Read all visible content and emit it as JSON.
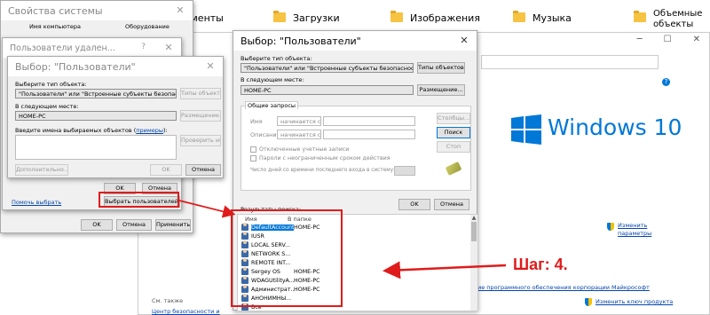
{
  "explorer": {
    "folders": [
      {
        "label": "ументы",
        "icon": "documents-folder-icon"
      },
      {
        "label": "Загрузки",
        "icon": "downloads-folder-icon"
      },
      {
        "label": "Изображения",
        "icon": "pictures-folder-icon"
      },
      {
        "label": "Музыка",
        "icon": "music-folder-icon"
      },
      {
        "label": "Объемные\nобъекты",
        "icon": "3d-objects-folder-icon"
      }
    ]
  },
  "system_panel": {
    "brand": "Windows 10",
    "change_params": "Изменить\nпараметры",
    "ms_license_link": "ие программного обеспечения корпорации Майкрософт",
    "change_key_link": "Изменить ключ продукта",
    "see_also": "См. также",
    "security_center": "Центр безопасности и"
  },
  "sysprops": {
    "title": "Свойства системы",
    "tabs": [
      "Имя компьютера",
      "Оборудование"
    ],
    "buttons": {
      "ok": "OK",
      "cancel": "Отмена",
      "apply": "Применить"
    }
  },
  "remote_users": {
    "title": "Пользователи удален...",
    "help_link": "Помочь выбрать",
    "select_users_btn": "Выбрать пользователей...",
    "buttons": {
      "ok": "OK",
      "cancel": "Отмена"
    }
  },
  "small_select": {
    "title": "Выбор: \"Пользователи\"",
    "object_type_label": "Выберите тип объекта:",
    "object_type_value": "\"Пользователи\" или \"Встроенные субъекты безопасности\"",
    "object_types_btn": "Типы объектов...",
    "location_label": "В следующем месте:",
    "location_value": "HOME-PC",
    "location_btn": "Размещение...",
    "enter_names_label": "Введите имена выбираемых объектов (",
    "examples_link": "примеры",
    "enter_names_suffix": "):",
    "check_names_btn": "Проверить имена",
    "advanced_btn": "Дополнительно...",
    "buttons": {
      "ok": "OK",
      "cancel": "Отмена"
    }
  },
  "main_select": {
    "title": "Выбор: \"Пользователи\"",
    "object_type_label": "Выберите тип объекта:",
    "object_type_value": "\"Пользователи\" или \"Встроенные субъекты безопасности\"",
    "object_types_btn": "Типы объектов...",
    "location_label": "В следующем месте:",
    "location_value": "HOME-PC",
    "location_btn": "Размещение...",
    "tab_common": "Общие запросы",
    "name_label": "Имя",
    "desc_label": "Описание",
    "starts_with": "начинается с",
    "columns_btn": "Столбцы...",
    "search_btn": "Поиск",
    "stop_btn": "Стоп",
    "disabled_accounts": "Отключенные учетные записи",
    "nonexpiring_pw": "Пароли с неограниченным сроком действия",
    "days_since_login": "Число дней со времени последнего входа в систему:",
    "buttons": {
      "ok": "OK",
      "cancel": "Отмена"
    },
    "results_label": "Результаты поиска:",
    "col_name": "Имя",
    "col_folder": "В папке",
    "results": [
      {
        "name": "DefaultAccount",
        "folder": "HOME-PC"
      },
      {
        "name": "IUSR",
        "folder": ""
      },
      {
        "name": "LOCAL SERV...",
        "folder": ""
      },
      {
        "name": "NETWORK S...",
        "folder": ""
      },
      {
        "name": "REMOTE INT...",
        "folder": ""
      },
      {
        "name": "Sergey OS",
        "folder": "HOME-PC"
      },
      {
        "name": "WDAGUtilityA...",
        "folder": "HOME-PC"
      },
      {
        "name": "Администрат...",
        "folder": "HOME-PC"
      },
      {
        "name": "АНОНИМНЫ...",
        "folder": ""
      },
      {
        "name": "Все",
        "folder": ""
      }
    ]
  },
  "annotation": {
    "step": "Шаг: 4.",
    "color": "#e01b1b"
  }
}
